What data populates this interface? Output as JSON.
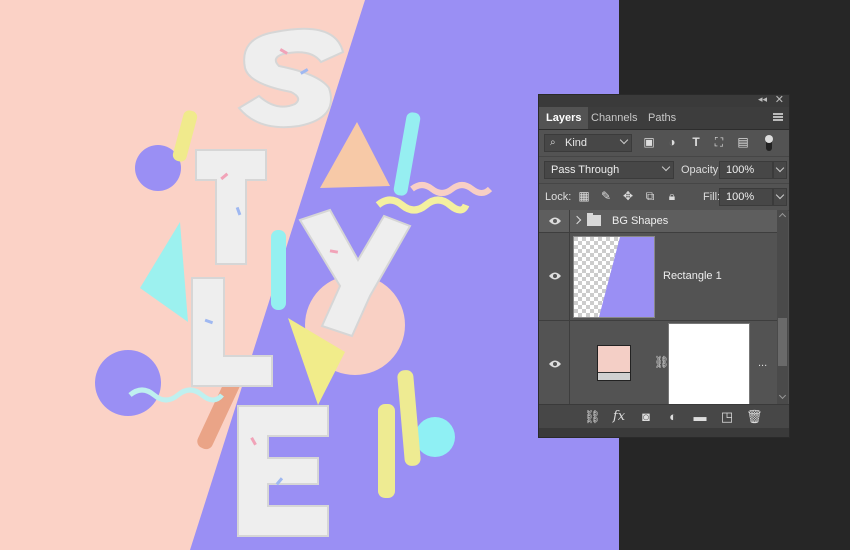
{
  "panel": {
    "tabs": [
      {
        "label": "Layers",
        "active": true
      },
      {
        "label": "Channels",
        "active": false
      },
      {
        "label": "Paths",
        "active": false
      }
    ],
    "filter": {
      "kind_label": "Kind",
      "icons": [
        "image-filter-icon",
        "adjustment-filter-icon",
        "type-filter-icon",
        "shape-filter-icon",
        "smart-object-filter-icon"
      ]
    },
    "blend_mode": "Pass Through",
    "opacity_label": "Opacity:",
    "opacity_value": "100%",
    "lock_label": "Lock:",
    "fill_label": "Fill:",
    "fill_value": "100%",
    "layers": [
      {
        "name": "BG Shapes",
        "type": "group",
        "visible": true
      },
      {
        "name": "Rectangle 1",
        "type": "shape",
        "visible": true
      },
      {
        "name": "",
        "type": "adjustment-with-mask",
        "visible": true,
        "more": "..."
      }
    ],
    "bottom_icons": [
      "link-layers-icon",
      "fx-icon",
      "add-mask-icon",
      "new-adjustment-icon",
      "new-group-icon",
      "new-layer-icon",
      "delete-icon"
    ],
    "fx_label": "fx"
  },
  "colors": {
    "peach": "#fbd2c6",
    "lavender": "#9a8ff4",
    "panel": "#535353",
    "dark_bg": "#262626"
  }
}
